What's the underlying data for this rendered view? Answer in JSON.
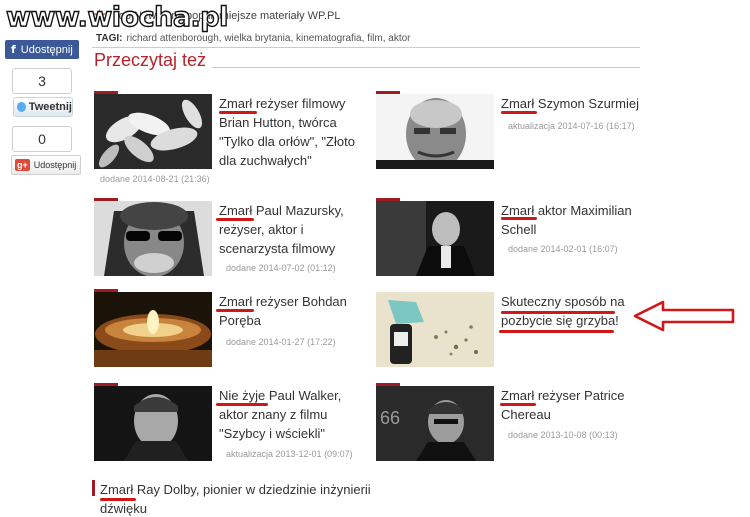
{
  "watermark": {
    "text": "www.wiocha.pl"
  },
  "share": {
    "facebook_label": "Udostępnij",
    "facebook_icon": "f",
    "facebook_count": "3",
    "twitter_label": "Tweetnij",
    "twitter_count": "0",
    "google_label": "Udostępnij",
    "google_icon": "g+"
  },
  "header": {
    "topnews": "Top News - najpopularniejsze materiały WP.PL",
    "tags_label": "TAGI:",
    "tags": "richard attenborough, wielka brytania, kinematografia, film, aktor",
    "section_title": "Przeczytaj też"
  },
  "articles": [
    {
      "title": "Zmarł reżyser filmowy Brian Hutton, twórca \"Tylko dla orłów\", \"Złoto dla zuchwałych\"",
      "date": "dodane 2014-08-21 (21:36)"
    },
    {
      "title": "Zmarł Szymon Szurmiej",
      "date": "aktualizacja 2014-07-16 (16:17)"
    },
    {
      "title": "Zmarł Paul Mazursky, reżyser, aktor i scenarzysta filmowy",
      "date": "dodane 2014-07-02 (01:12)"
    },
    {
      "title": "Zmarł aktor Maximilian Schell",
      "date": "dodane 2014-02-01 (16:07)"
    },
    {
      "title": "Zmarł reżyser Bohdan Poręba",
      "date": "dodane 2014-01-27 (17:22)"
    },
    {
      "title": "Skuteczny sposób na pozbycie się grzyba!",
      "date": ""
    },
    {
      "title": "Nie żyje Paul Walker, aktor znany z filmu \"Szybcy i wściekli\"",
      "date": "aktualizacja 2013-12-01 (09:07)"
    },
    {
      "title": "Zmarł reżyser Patrice Chereau",
      "date": "dodane 2013-10-08 (00:13)"
    }
  ],
  "last_article": {
    "title": "Zmarł Ray Dolby, pionier w dziedzinie inżynierii dźwięku"
  },
  "colors": {
    "accent": "#b5232a",
    "annotation": "#d01818",
    "facebook": "#3b5998"
  }
}
